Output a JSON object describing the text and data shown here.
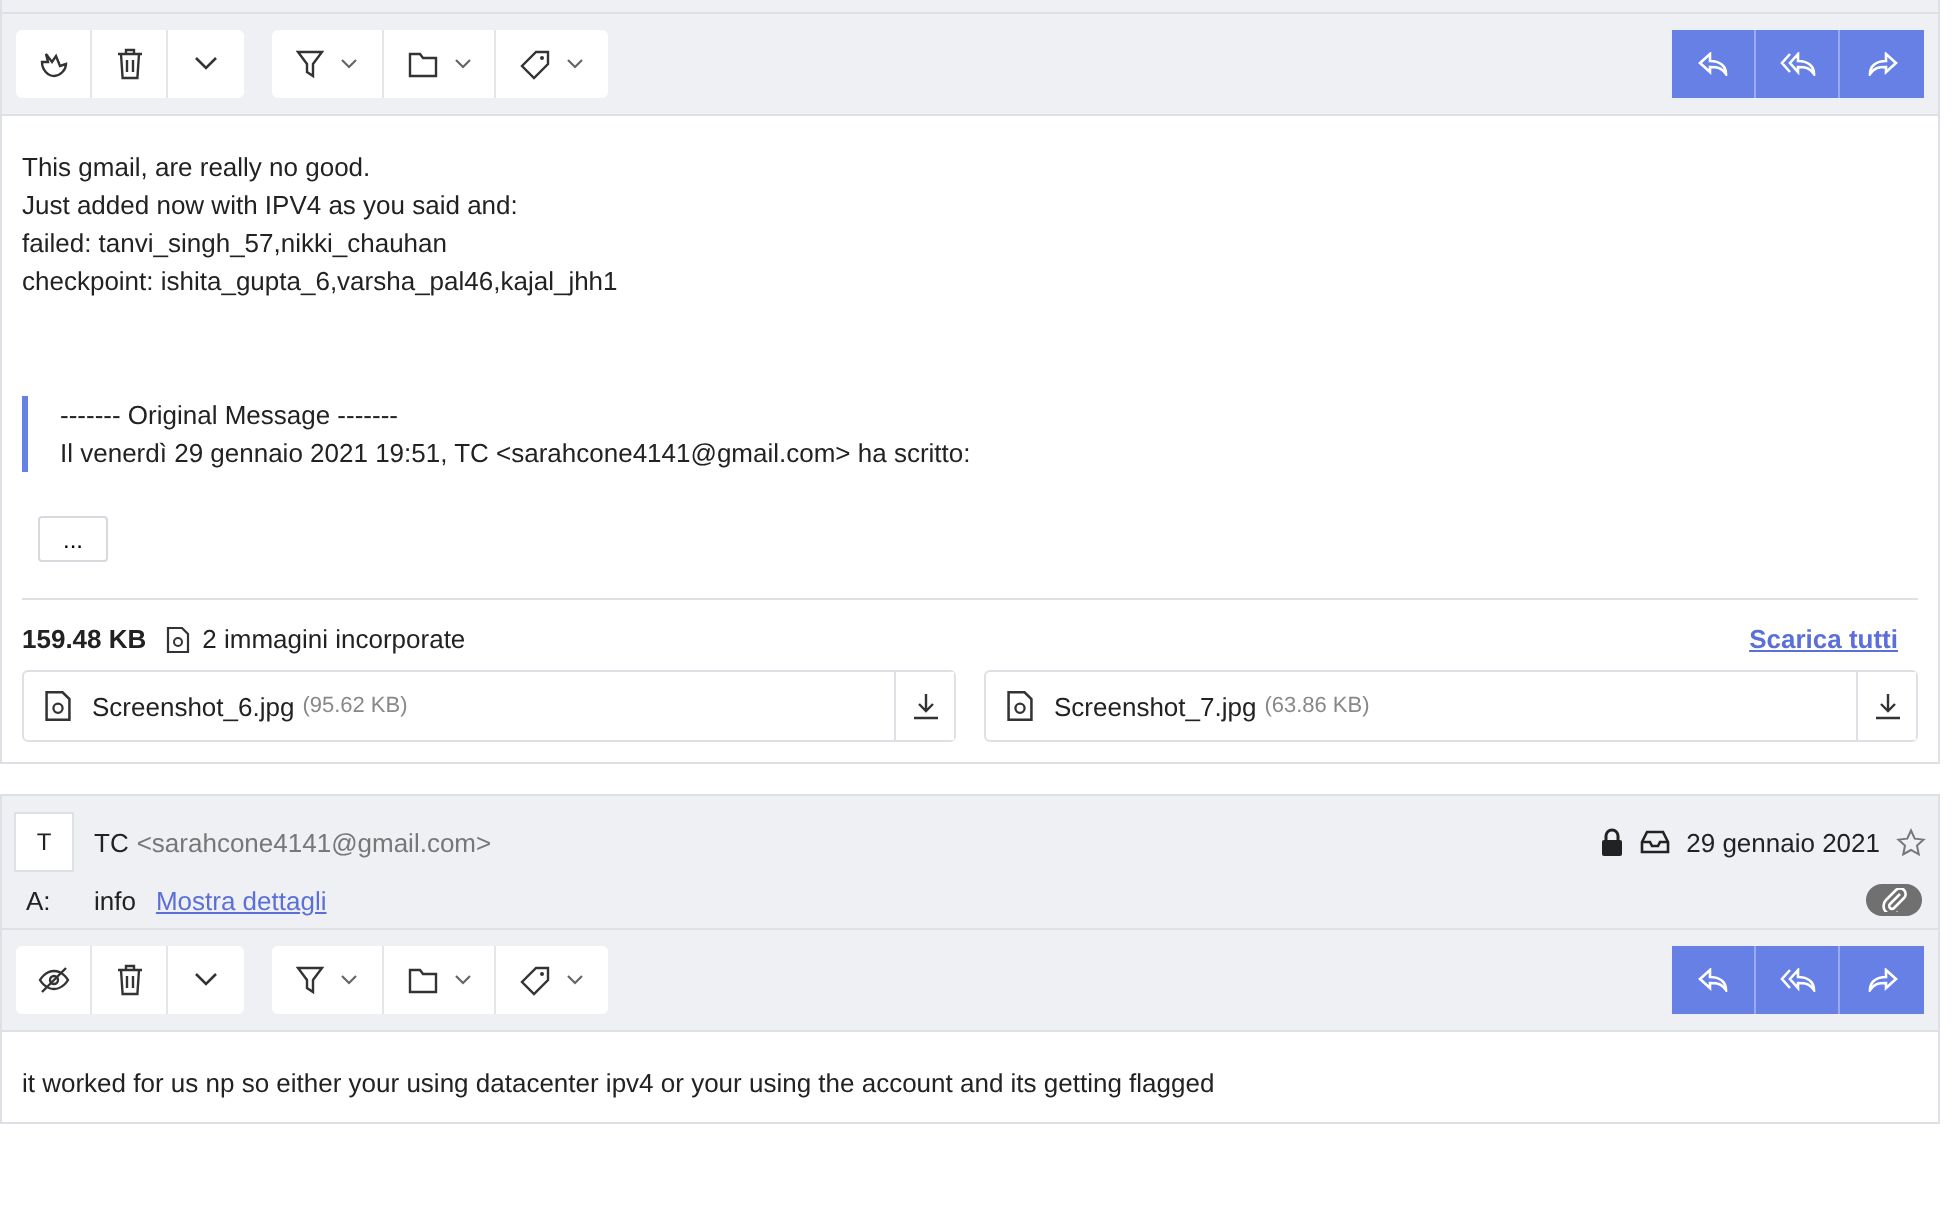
{
  "messages": [
    {
      "seen": false,
      "body_lines": [
        "This gmail, are really no good.",
        "Just added now with IPV4 as you said and:",
        "failed: tanvi_singh_57,nikki_chauhan",
        "checkpoint: ishita_gupta_6,varsha_pal46,kajal_jhh1"
      ],
      "quote": {
        "title": "------- Original Message -------",
        "line": "Il venerdì 29 gennaio 2021 19:51, TC <sarahcone4141@gmail.com> ha scritto:"
      },
      "more_button": "...",
      "attachments": {
        "size": "159.48 KB",
        "summary": "2 immagini incorporate",
        "download_all": "Scarica tutti",
        "files": [
          {
            "name": "Screenshot_6.jpg",
            "size": "(95.62 KB)"
          },
          {
            "name": "Screenshot_7.jpg",
            "size": "(63.86 KB)"
          }
        ]
      }
    },
    {
      "avatar": "T",
      "sender": "TC",
      "email": "<sarahcone4141@gmail.com>",
      "date": "29 gennaio 2021",
      "starred": false,
      "to_label": "A:",
      "recipient": "info",
      "details_link": "Mostra dettagli",
      "seen": true,
      "body_lines": [
        "it worked for us np so either your using datacenter ipv4 or your using the account and its getting flagged"
      ]
    }
  ]
}
